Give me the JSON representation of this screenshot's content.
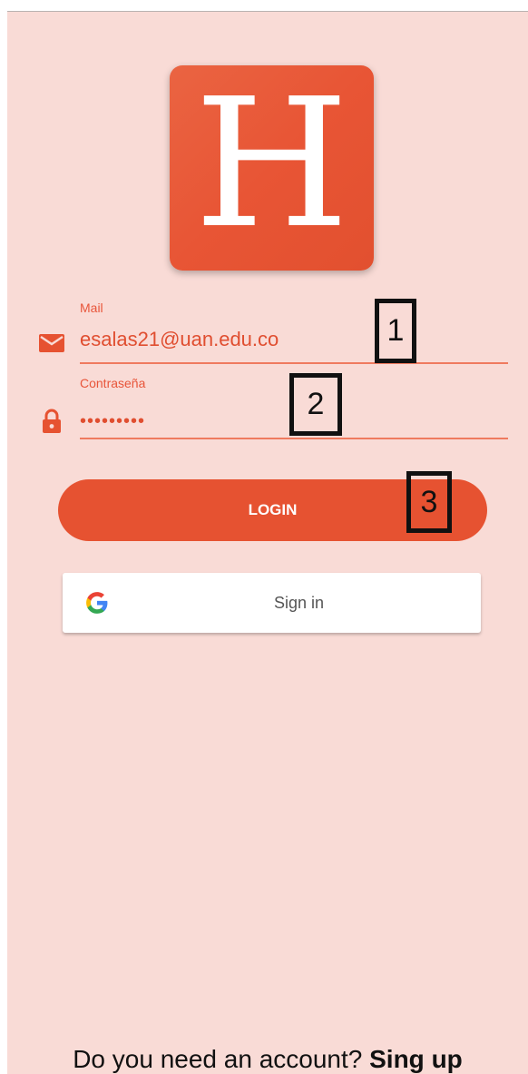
{
  "logo": {
    "letter": "H"
  },
  "mail_field": {
    "label": "Mail",
    "value": "esalas21@uan.edu.co",
    "icon": "mail-icon"
  },
  "password_field": {
    "label": "Contraseña",
    "masked_value": "•••••••••",
    "icon": "lock-icon"
  },
  "annotations": [
    "1",
    "2",
    "3"
  ],
  "login_button": {
    "label": "LOGIN"
  },
  "google_button": {
    "label": "Sign in",
    "icon": "google-icon"
  },
  "footer": {
    "prompt": "Do you need an account?",
    "link": "Sing up"
  },
  "colors": {
    "background": "#f9dbd6",
    "accent": "#e65231",
    "logo": "#e85535"
  }
}
